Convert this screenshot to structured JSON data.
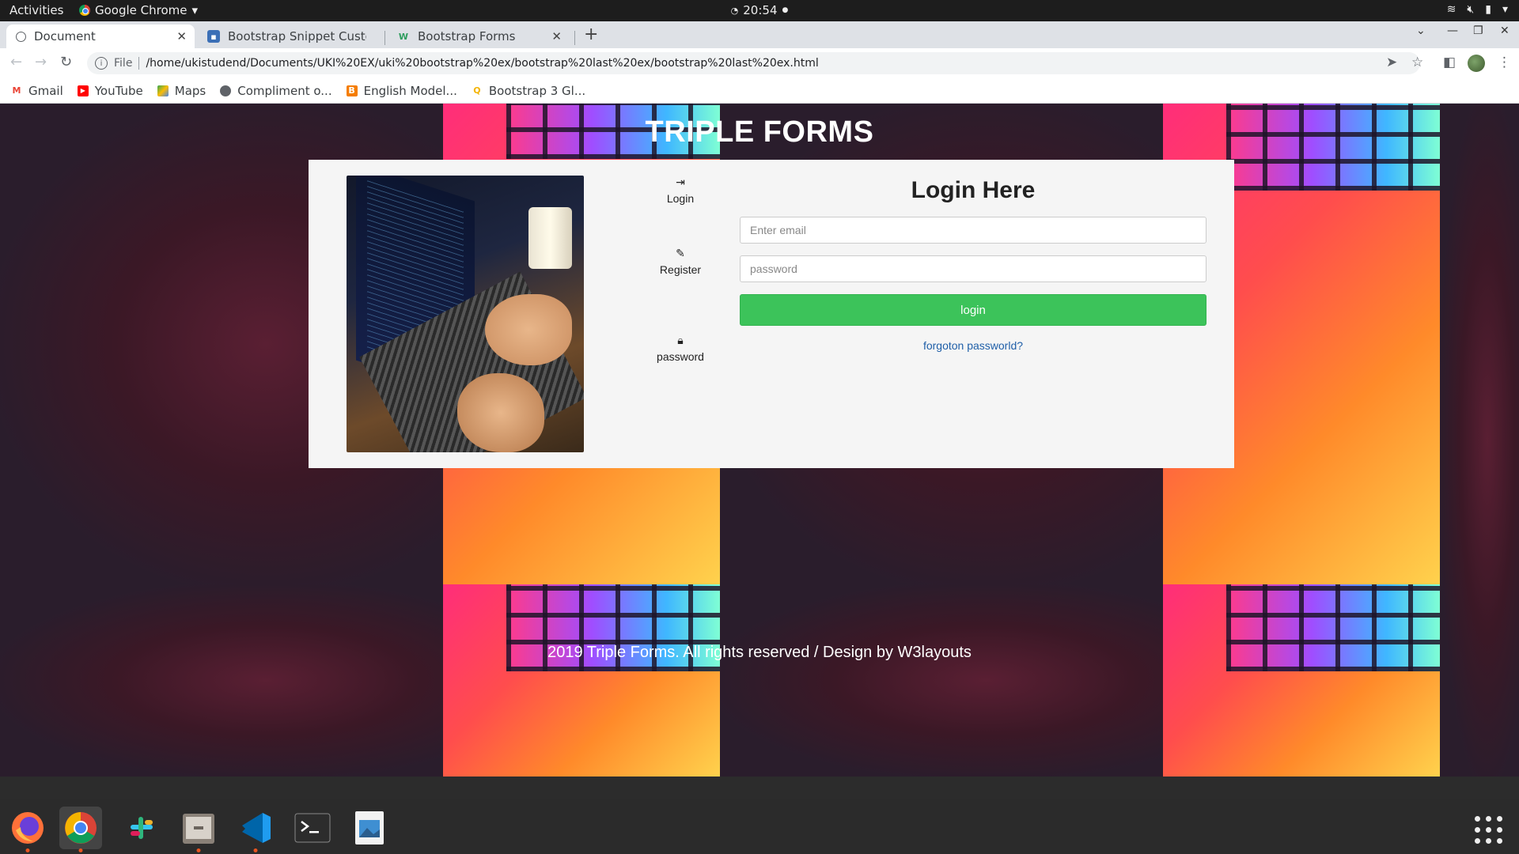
{
  "system_bar": {
    "activities": "Activities",
    "app_name": "Google Chrome",
    "clock": "20:54"
  },
  "browser": {
    "tabs": [
      {
        "label": "Document",
        "active": true
      },
      {
        "label": "Bootstrap Snippet Custor",
        "active": false
      },
      {
        "label": "Bootstrap Forms",
        "active": false
      }
    ],
    "address": {
      "scheme": "File",
      "url": "/home/ukistudend/Documents/UKI%20EX/uki%20bootstrap%20ex/bootstrap%20last%20ex/bootstrap%20last%20ex.html"
    },
    "bookmarks": [
      {
        "label": "Gmail",
        "icon": "gmail-icon",
        "color": "#ea4335"
      },
      {
        "label": "YouTube",
        "icon": "youtube-icon",
        "color": "#ff0000"
      },
      {
        "label": "Maps",
        "icon": "maps-icon",
        "color": "#34a853"
      },
      {
        "label": "Compliment o...",
        "icon": "globe-icon",
        "color": "#5f6368"
      },
      {
        "label": "English Model...",
        "icon": "blogger-icon",
        "color": "#f57d00"
      },
      {
        "label": "Bootstrap 3 Gl...",
        "icon": "search-icon",
        "color": "#f4b400"
      }
    ]
  },
  "page": {
    "heading": "TRIPLE FORMS",
    "nav": [
      {
        "label": "Login",
        "icon": "sign-in-icon"
      },
      {
        "label": "Register",
        "icon": "pencil-icon"
      },
      {
        "label": "password",
        "icon": "lock-icon"
      }
    ],
    "form": {
      "title": "Login Here",
      "email_placeholder": "Enter email",
      "password_placeholder": "password",
      "submit_label": "login",
      "forgot_link": "forgoton passworld?"
    },
    "footer": "2019 Triple Forms. All rights reserved / Design by W3layouts",
    "colors": {
      "button": "#3cc35a",
      "link": "#1f5fa8"
    }
  },
  "dock": {
    "apps": [
      "firefox-icon",
      "chrome-icon",
      "slack-icon",
      "files-icon",
      "vscode-icon",
      "terminal-icon",
      "image-viewer-icon"
    ]
  }
}
